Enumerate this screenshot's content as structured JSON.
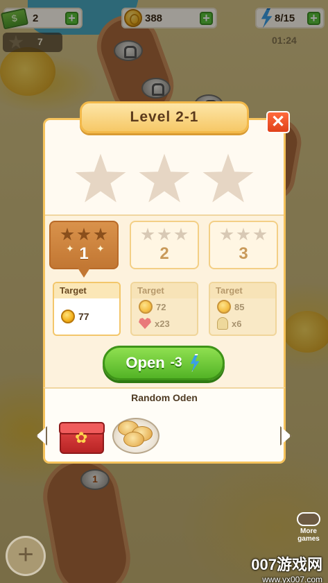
{
  "hud": {
    "cash": "2",
    "coins": "388",
    "energy": "8/15",
    "stars": "7",
    "timer": "01:24",
    "plus_label": "+"
  },
  "map": {
    "node_number": "1"
  },
  "dialog": {
    "title": "Level  2-1",
    "close_label": "✕",
    "tabs": [
      {
        "number": "1",
        "selected": true
      },
      {
        "number": "2",
        "selected": false
      },
      {
        "number": "3",
        "selected": false
      }
    ],
    "targets": [
      {
        "header": "Target",
        "coins": "77"
      },
      {
        "header": "Target",
        "coins": "72",
        "hearts": "x23"
      },
      {
        "header": "Target",
        "coins": "85",
        "people": "x6"
      }
    ],
    "open_button": {
      "label": "Open",
      "cost": "-3"
    },
    "reward": {
      "title": "Random Oden"
    }
  },
  "bottom": {
    "add_label": "+",
    "more_games": "More games"
  },
  "watermark": {
    "line1": "007游戏网",
    "line2": "www.yx007.com"
  },
  "colors": {
    "dialog_border": "#f5c25c",
    "selected_tab": "#c27733",
    "open_button": "#53b326",
    "close_button": "#e0421a",
    "energy_bolt": "#3b9fe6"
  },
  "icons": [
    "cash-icon",
    "coin-icon",
    "bolt-icon",
    "star-icon",
    "lock-icon",
    "heart-icon",
    "person-icon",
    "gift-box-icon",
    "oden-plate-icon",
    "gamepad-icon",
    "chevron-left-icon",
    "chevron-right-icon"
  ]
}
